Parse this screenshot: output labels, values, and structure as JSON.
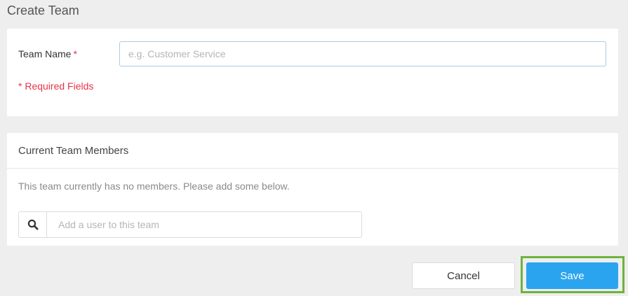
{
  "page": {
    "title": "Create Team"
  },
  "team_form": {
    "name_label": "Team Name",
    "required_marker": "*",
    "name_placeholder": "e.g. Customer Service",
    "name_value": "",
    "required_note": "* Required Fields"
  },
  "members": {
    "header": "Current Team Members",
    "empty_message": "This team currently has no members. Please add some below.",
    "search_icon": "search-icon",
    "search_placeholder": "Add a user to this team",
    "search_value": ""
  },
  "actions": {
    "cancel_label": "Cancel",
    "save_label": "Save"
  },
  "colors": {
    "background": "#eeeeee",
    "required": "#e8334a",
    "primary": "#2ba4ef",
    "highlight": "#6db33f"
  }
}
